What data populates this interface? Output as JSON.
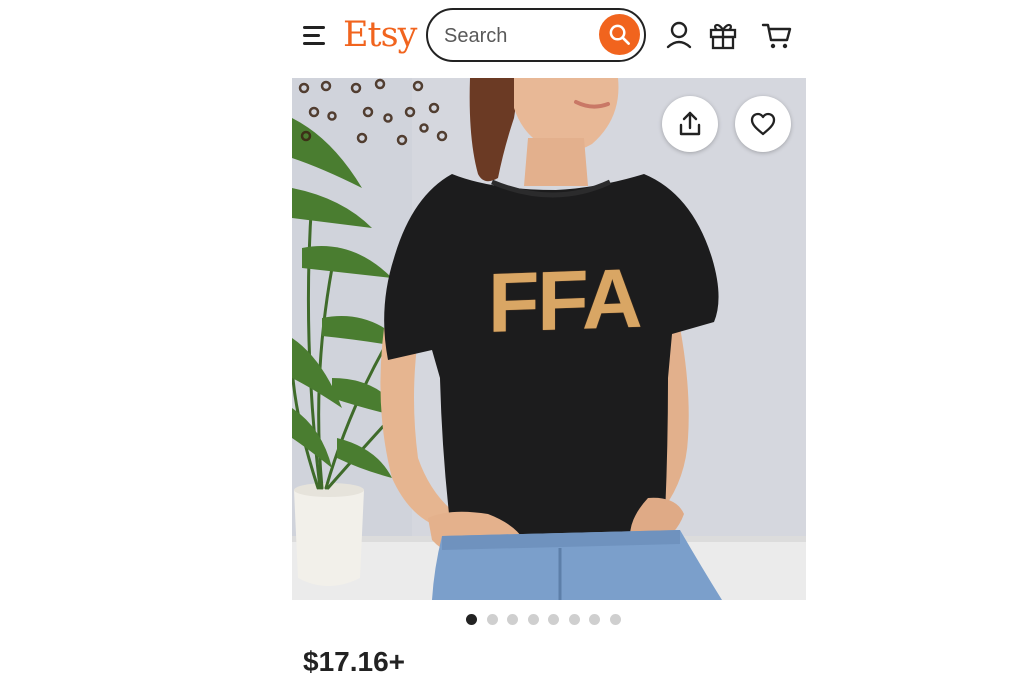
{
  "header": {
    "menu_icon": "hamburger-menu-icon",
    "logo_text": "Etsy",
    "brand_color": "#F1641E",
    "search": {
      "placeholder": "Search",
      "value": "",
      "button_icon": "search-icon"
    },
    "icons": [
      "account-icon",
      "gift-icon",
      "cart-icon"
    ]
  },
  "hero": {
    "shirt_print": "FFA",
    "actions": [
      "share-icon",
      "heart-icon"
    ]
  },
  "carousel": {
    "total": 8,
    "active_index": 0
  },
  "product": {
    "price": "$17.16+"
  }
}
